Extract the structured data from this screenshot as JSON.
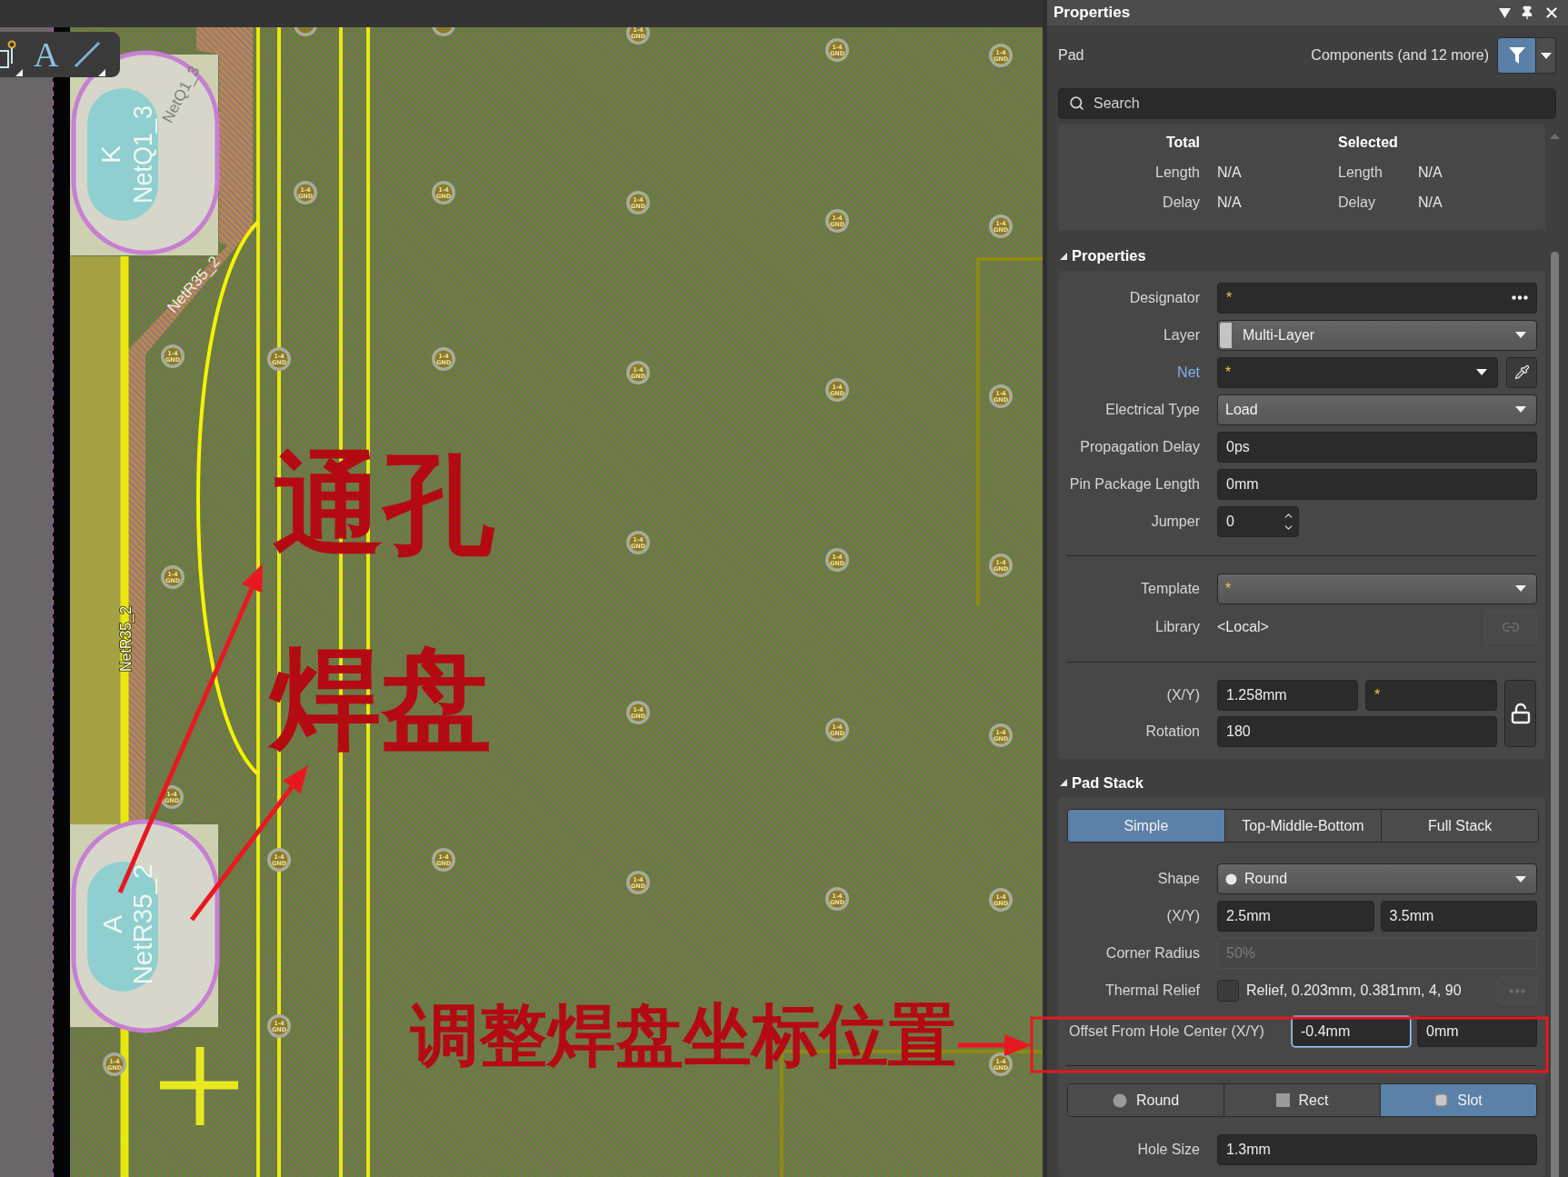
{
  "canvas": {
    "toolbar": [
      {
        "kind": "pin",
        "menu": true
      },
      {
        "kind": "text",
        "text": "A",
        "menu": false
      },
      {
        "kind": "line",
        "menu": true
      }
    ],
    "board": {
      "pads": [
        {
          "pin": "K",
          "net": "NetQ1_3"
        },
        {
          "pin": "A",
          "net": "NetR35_2"
        }
      ],
      "net_labels": [
        "NetQ1_3",
        "NetR35_2",
        "NetR35_2"
      ],
      "vias": [
        {
          "layers": "1-4",
          "net": "GND"
        },
        {
          "layers": "1-4",
          "net": "GND"
        },
        {
          "layers": "1-4",
          "net": "GND"
        },
        {
          "layers": "1-4",
          "net": "GND"
        },
        {
          "layers": "1-4",
          "net": "GND"
        },
        {
          "layers": "1-4",
          "net": "GND"
        },
        {
          "layers": "1-4",
          "net": "GND"
        },
        {
          "layers": "1-4",
          "net": "GND"
        },
        {
          "layers": "1-4",
          "net": "GND"
        },
        {
          "layers": "1-4",
          "net": "GND"
        },
        {
          "layers": "1-4",
          "net": "GND"
        },
        {
          "layers": "1-4",
          "net": "GND"
        },
        {
          "layers": "1-4",
          "net": "GND"
        },
        {
          "layers": "1-4",
          "net": "GND"
        },
        {
          "layers": "1-4",
          "net": "GND"
        },
        {
          "layers": "1-4",
          "net": "GND"
        },
        {
          "layers": "1-4",
          "net": "GND"
        },
        {
          "layers": "1-4",
          "net": "GND"
        },
        {
          "layers": "1-4",
          "net": "GND"
        },
        {
          "layers": "1-4",
          "net": "GND"
        },
        {
          "layers": "1-4",
          "net": "GND"
        },
        {
          "layers": "1-4",
          "net": "GND"
        },
        {
          "layers": "1-4",
          "net": "GND"
        },
        {
          "layers": "1-4",
          "net": "GND"
        },
        {
          "layers": "1-4",
          "net": "GND"
        },
        {
          "layers": "1-4",
          "net": "GND"
        },
        {
          "layers": "1-4",
          "net": "GND"
        },
        {
          "layers": "1-4",
          "net": "GND"
        },
        {
          "layers": "1-4",
          "net": "GND"
        },
        {
          "layers": "1-4",
          "net": "GND"
        }
      ]
    },
    "annotations": {
      "labels": [
        "通孔",
        "焊盘",
        "调整焊盘坐标位置"
      ]
    }
  },
  "panel": {
    "title": "Properties",
    "object_type": "Pad",
    "filter": "Components (and 12 more)",
    "search": {
      "placeholder": "Search"
    },
    "summary": [
      {
        "heading": "Total",
        "rows": [
          {
            "label": "Length",
            "value": "N/A"
          },
          {
            "label": "Delay",
            "value": "N/A"
          }
        ]
      },
      {
        "heading": "Selected",
        "rows": [
          {
            "label": "Length",
            "value": "N/A"
          },
          {
            "label": "Delay",
            "value": "N/A"
          }
        ]
      }
    ],
    "sections": [
      {
        "title": "Properties",
        "expanded": true,
        "items": [
          {
            "kind": "field",
            "label": "Designator",
            "value": "*",
            "mixed": true,
            "more": true
          },
          {
            "kind": "layer",
            "label": "Layer",
            "value": "Multi-Layer"
          },
          {
            "kind": "net",
            "label": "Net",
            "value": "*",
            "mixed": true,
            "link": true
          },
          {
            "kind": "dropdown",
            "label": "Electrical Type",
            "value": "Load"
          },
          {
            "kind": "field",
            "label": "Propagation Delay",
            "value": "0ps"
          },
          {
            "kind": "field",
            "label": "Pin Package Length",
            "value": "0mm"
          },
          {
            "kind": "spin",
            "label": "Jumper",
            "value": "0"
          },
          {
            "kind": "divider"
          },
          {
            "kind": "dropdown",
            "label": "Template",
            "value": "*",
            "mixed": true
          },
          {
            "kind": "static",
            "label": "Library",
            "value": "<Local>",
            "button_disabled": true
          },
          {
            "kind": "divider"
          },
          {
            "kind": "placement",
            "locked": false,
            "rows": [
              {
                "label": "(X/Y)",
                "values": [
                  {
                    "value": "1.258mm"
                  },
                  {
                    "value": "*",
                    "mixed": true
                  }
                ]
              },
              {
                "label": "Rotation",
                "values": [
                  {
                    "value": "180"
                  }
                ]
              }
            ]
          }
        ]
      },
      {
        "title": "Pad Stack",
        "expanded": true,
        "items": [
          {
            "kind": "tabs",
            "tabs": [
              {
                "label": "Simple",
                "selected": true
              },
              {
                "label": "Top-Middle-Bottom",
                "selected": false
              },
              {
                "label": "Full Stack",
                "selected": false
              }
            ]
          },
          {
            "kind": "shape",
            "label": "Shape",
            "value": "Round"
          },
          {
            "kind": "xy",
            "label": "(X/Y)",
            "values": [
              {
                "value": "2.5mm"
              },
              {
                "value": "3.5mm"
              }
            ]
          },
          {
            "kind": "field",
            "label": "Corner Radius",
            "value": "50%",
            "disabled": true
          },
          {
            "kind": "checkbox",
            "label": "Thermal Relief",
            "checked": false,
            "value": "Relief, 0.203mm, 0.381mm, 4, 90",
            "button_disabled": true
          },
          {
            "kind": "offset",
            "label": "Offset From Hole Center (X/Y)",
            "values": [
              {
                "value": "-0.4mm",
                "focused": true
              },
              {
                "value": "0mm"
              }
            ]
          },
          {
            "kind": "divider"
          },
          {
            "kind": "tabs",
            "tabs": [
              {
                "kind": "round",
                "label": "Round",
                "selected": false
              },
              {
                "kind": "rect",
                "label": "Rect",
                "selected": false
              },
              {
                "kind": "slot",
                "label": "Slot",
                "selected": true
              }
            ]
          },
          {
            "kind": "field",
            "label": "Hole Size",
            "value": "1.3mm"
          }
        ]
      }
    ]
  }
}
